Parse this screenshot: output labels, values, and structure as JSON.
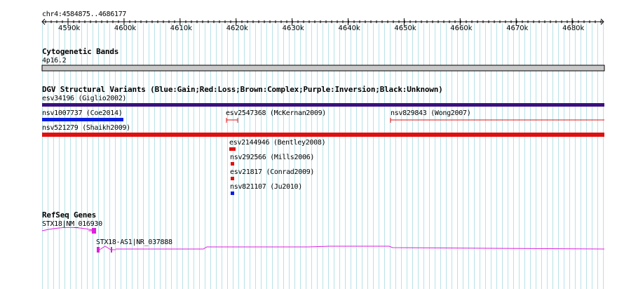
{
  "ruler": {
    "region": "chr4:4584875..4686177",
    "ticks": [
      "4590k",
      "4600k",
      "4610k",
      "4620k",
      "4630k",
      "4640k",
      "4650k",
      "4660k",
      "4670k",
      "4680k"
    ]
  },
  "cytoband": {
    "title": "Cytogenetic Bands",
    "band": "4p16.2"
  },
  "dgv": {
    "title": "DGV Structural Variants (Blue:Gain;Red:Loss;Brown:Complex;Purple:Inversion;Black:Unknown)",
    "variants": [
      {
        "label": "esv34196 (Giglio2002)",
        "type": "inversion",
        "color": "#3b1080"
      },
      {
        "label": "nsv1007737 (Coe2014)",
        "type": "gain",
        "color": "#0b1ee0"
      },
      {
        "label": "esv2547368 (McKernan2009)",
        "type": "loss",
        "color": "#e01010"
      },
      {
        "label": "nsv829843 (Wong2007)",
        "type": "loss",
        "color": "#e01010"
      },
      {
        "label": "nsv521279 (Shaikh2009)",
        "type": "loss",
        "color": "#e01010"
      },
      {
        "label": "esv2144946 (Bentley2008)",
        "type": "loss",
        "color": "#e01010"
      },
      {
        "label": "nsv292566 (Mills2006)",
        "type": "loss",
        "color": "#e01010"
      },
      {
        "label": "esv21817 (Conrad2009)",
        "type": "loss",
        "color": "#e01010"
      },
      {
        "label": "nsv821107 (Ju2010)",
        "type": "gain",
        "color": "#0b1ee0"
      }
    ]
  },
  "refseq": {
    "title": "RefSeq Genes",
    "genes": [
      {
        "label": "STX18|NM_016930",
        "color": "#dd22dd"
      },
      {
        "label": "STX18-AS1|NR_037888",
        "color": "#dd22dd"
      }
    ]
  },
  "colors": {
    "grid": "#b8e2e8",
    "axis": "#000000",
    "gene": "#dd22dd",
    "band": "#c8c8c8"
  }
}
